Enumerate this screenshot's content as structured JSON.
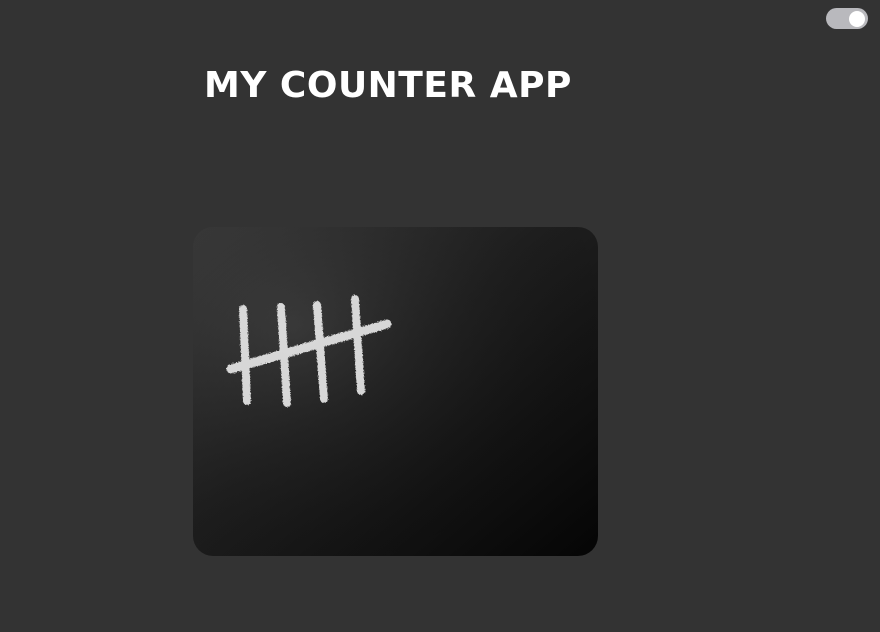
{
  "app": {
    "title": "MY COUNTER APP"
  },
  "theme_toggle": {
    "state": "on",
    "icon": "toggle-switch-icon",
    "track_color": "#b9b9bd",
    "knob_color": "#ffffff"
  },
  "hero_image": {
    "icon": "tally-marks-chalkboard-image",
    "tally_count": 5
  },
  "colors": {
    "background": "#333333",
    "title": "#ffffff",
    "chalkboard": "#111111",
    "chalk": "#e8e8e8"
  }
}
